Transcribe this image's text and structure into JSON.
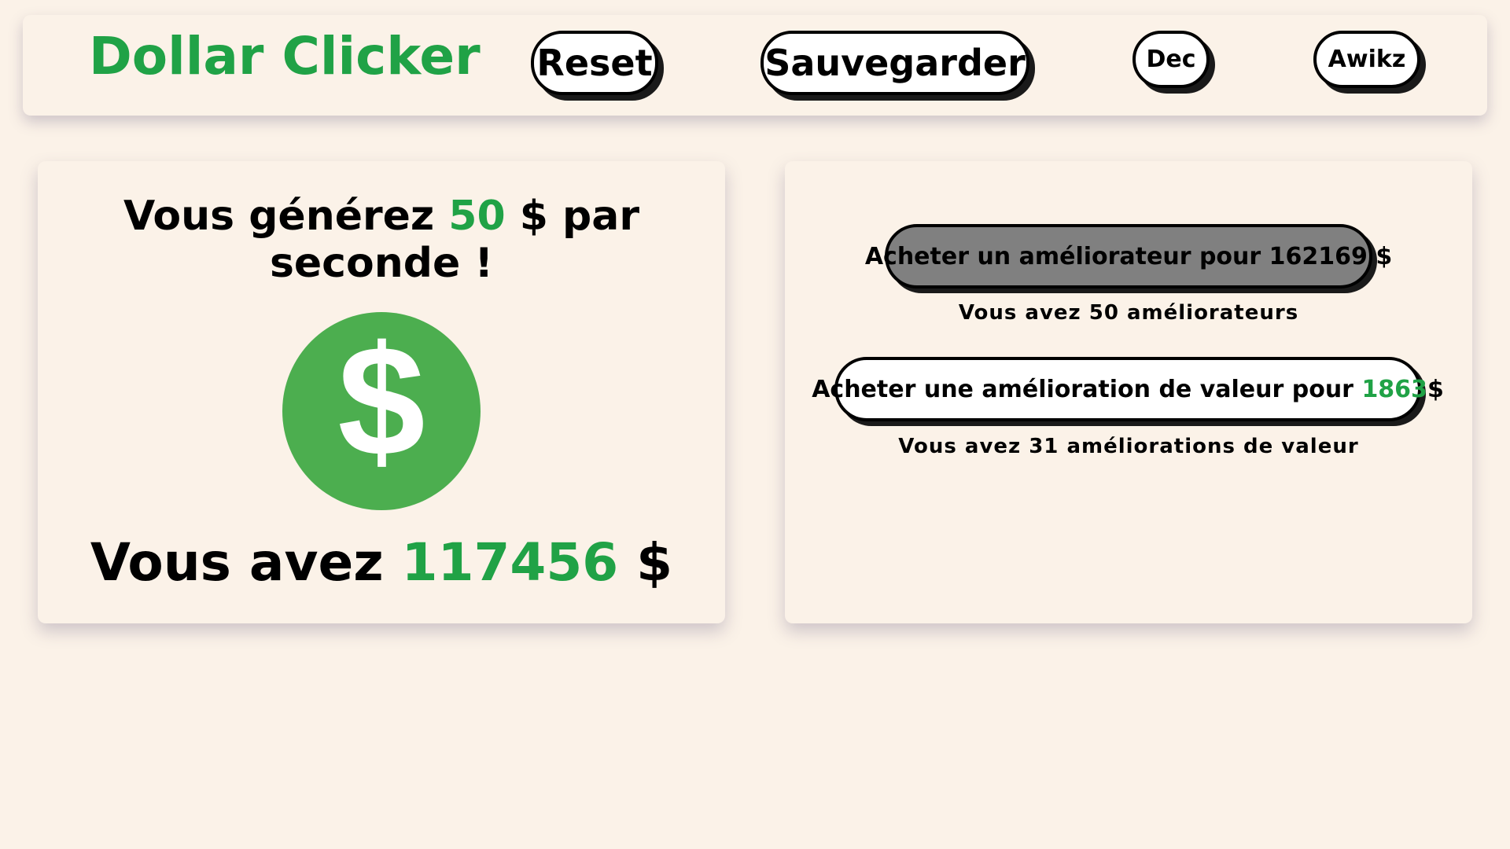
{
  "header": {
    "title": "Dollar Clicker",
    "reset_label": "Reset",
    "save_label": "Sauvegarder",
    "dec_label": "Dec",
    "awikz_label": "Awikz"
  },
  "generator": {
    "prefix": "Vous générez ",
    "rate": "50",
    "suffix": " $ par seconde !",
    "total_prefix": "Vous avez ",
    "total": "117456",
    "total_suffix": " $",
    "coin_icon": "dollar-sign-icon"
  },
  "upgrades": {
    "improver": {
      "label": "Acheter un améliorateur pour 162169 $",
      "caption": "Vous avez 50 améliorateurs"
    },
    "value": {
      "label_prefix": "Acheter une amélioration de valeur pour ",
      "price": "1863",
      "label_suffix": " $",
      "caption": "Vous avez 31 améliorations de valeur"
    }
  },
  "colors": {
    "accent_green": "#20a246",
    "coin_green": "#4cae4f",
    "background": "#fbf2e8",
    "disabled_button": "#808080"
  }
}
